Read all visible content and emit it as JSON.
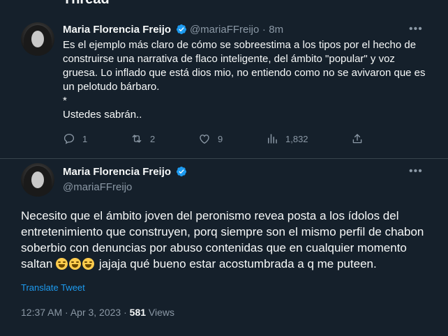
{
  "header": {
    "title": "Thread"
  },
  "tweet1": {
    "name": "Maria Florencia Freijo",
    "handle": "@mariaFFreijo",
    "dot": "·",
    "time": "8m",
    "text": "Es el ejemplo más claro de cómo se sobreestima a los tipos por el hecho de construirse una narrativa de flaco inteligente, del ámbito \"popular\" y voz gruesa. Lo inflado que está dios mio, no entiendo como no se avivaron que es un pelotudo bárbaro.\n*\nUstedes sabrán..",
    "replies": "1",
    "retweets": "2",
    "likes": "9",
    "views": "1,832"
  },
  "tweet2": {
    "name": "Maria Florencia Freijo",
    "handle": "@mariaFFreijo",
    "text_before": "Necesito que el ámbito joven del peronismo revea posta a los ídolos del entretenimiento que construyen, porq siempre son el mismo perfil de chabon soberbio con denuncias por abuso contenidas que en cualquier momento saltan ",
    "emojis": [
      "face-with-tears-of-joy",
      "face-with-tears-of-joy",
      "face-with-tears-of-joy"
    ],
    "text_after": " jajaja qué bueno estar acostumbrada a q me puteen.",
    "translate": "Translate Tweet",
    "timestamp": "12:37 AM · Apr 3, 2023 · ",
    "views_count": "581",
    "views_label": " Views"
  },
  "colors": {
    "background": "#15202b",
    "accent": "#1d9bf0",
    "muted": "#8b98a5",
    "divider": "#38444d"
  }
}
